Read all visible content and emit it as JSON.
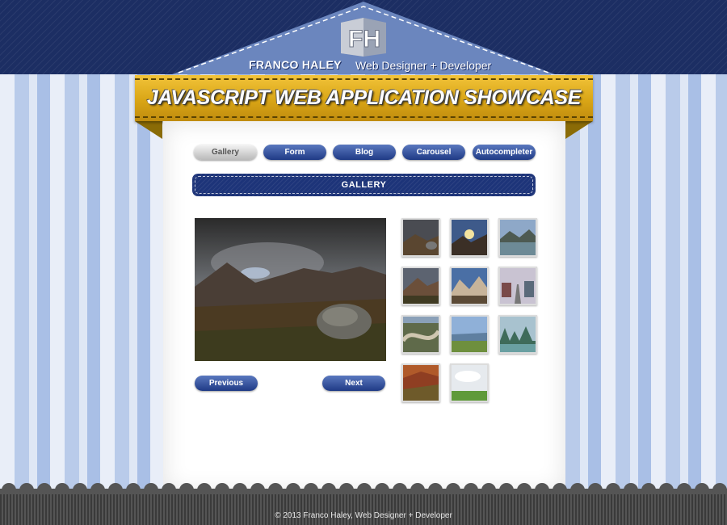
{
  "header": {
    "brand_name": "FRANCO HALEY",
    "brand_tagline": "Web Designer + Developer",
    "logo_text": "FH"
  },
  "banner": {
    "title": "JAVASCRIPT WEB APPLICATION SHOWCASE"
  },
  "nav": {
    "items": [
      {
        "label": "Gallery",
        "active": true
      },
      {
        "label": "Form",
        "active": false
      },
      {
        "label": "Blog",
        "active": false
      },
      {
        "label": "Carousel",
        "active": false
      },
      {
        "label": "Autocompleter",
        "active": false
      }
    ]
  },
  "section": {
    "title": "GALLERY"
  },
  "gallery": {
    "thumbnails": [
      "landscape-stormy-moor",
      "landscape-sunburst-valley",
      "landscape-lake-mountains",
      "landscape-highland-peak",
      "landscape-blue-mountains",
      "landscape-town-street",
      "landscape-road-aerial",
      "landscape-green-valley",
      "landscape-karst-river",
      "landscape-autumn-hills",
      "landscape-green-field"
    ],
    "previous_label": "Previous",
    "next_label": "Next"
  },
  "footer": {
    "text": "© 2013   Franco Haley, Web Designer + Developer"
  },
  "colors": {
    "navy": "#1c2e63",
    "gold": "#d9a516",
    "pill_blue": "#1f3a85",
    "stripe_light": "#e9eef8",
    "stripe_blue": "#b9cbea"
  }
}
